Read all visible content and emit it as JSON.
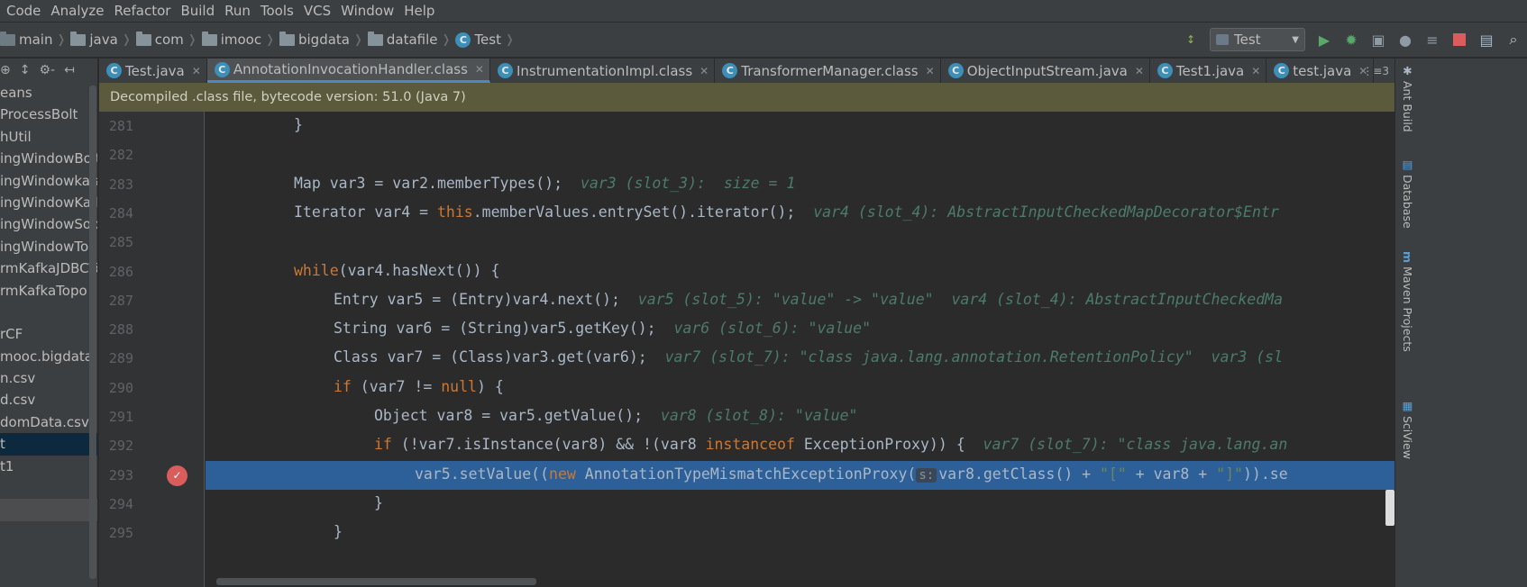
{
  "menu": [
    "Code",
    "Analyze",
    "Refactor",
    "Build",
    "Run",
    "Tools",
    "VCS",
    "Window",
    "Help"
  ],
  "breadcrumbs": [
    {
      "label": "main",
      "icon": "folder-icon"
    },
    {
      "label": "java",
      "icon": "folder-icon"
    },
    {
      "label": "com",
      "icon": "folder-icon"
    },
    {
      "label": "imooc",
      "icon": "folder-icon"
    },
    {
      "label": "bigdata",
      "icon": "folder-icon"
    },
    {
      "label": "datafile",
      "icon": "folder-icon"
    },
    {
      "label": "Test",
      "icon": "class-icon"
    }
  ],
  "run_config": {
    "label": "Test"
  },
  "project": {
    "items": [
      "eans",
      "ProcessBolt",
      "hUtil",
      "ingWindowBolt",
      "ingWindowkafaB",
      "ingWindowKafka",
      "ingWindowSopu",
      "ingWindowTopo",
      "rmKafkaJDBCTop",
      "rmKafkaTopo",
      "",
      "rCF",
      "mooc.bigdata.dat",
      "n.csv",
      "d.csv",
      "domData.csv",
      "t",
      "t1",
      "",
      "",
      ""
    ]
  },
  "tabs": [
    {
      "label": "Test.java",
      "active": false
    },
    {
      "label": "AnnotationInvocationHandler.class",
      "active": true
    },
    {
      "label": "InstrumentationImpl.class",
      "active": false
    },
    {
      "label": "TransformerManager.class",
      "active": false
    },
    {
      "label": "ObjectInputStream.java",
      "active": false
    },
    {
      "label": "Test1.java",
      "active": false
    },
    {
      "label": "test.java",
      "active": false
    }
  ],
  "tab_more": "⋮≡3",
  "banner": "Decompiled .class file, bytecode version: 51.0 (Java 7)",
  "lines": [
    {
      "num": "281"
    },
    {
      "num": "282"
    },
    {
      "num": "283"
    },
    {
      "num": "284"
    },
    {
      "num": "285"
    },
    {
      "num": "286"
    },
    {
      "num": "287"
    },
    {
      "num": "288"
    },
    {
      "num": "289"
    },
    {
      "num": "290"
    },
    {
      "num": "291"
    },
    {
      "num": "292"
    },
    {
      "num": "293"
    },
    {
      "num": "294"
    },
    {
      "num": "295"
    }
  ],
  "code": {
    "l281": "}",
    "l283a": "Map var3 = var2.memberTypes();",
    "l283b": "var3 (slot_3):  size = 1",
    "l284a": "Iterator var4 = ",
    "l284kw": "this",
    "l284b": ".memberValues.entrySet().iterator();",
    "l284c": "var4 (slot_4): AbstractInputCheckedMapDecorator$Entr",
    "l286kw": "while",
    "l286b": "(var4.hasNext()) {",
    "l287a": "Entry var5 = (Entry)var4.next();",
    "l287b": "var5 (slot_5): \"value\" -> \"value\"  var4 (slot_4): AbstractInputCheckedMa",
    "l288a": "String var6 = (String)var5.getKey();",
    "l288b": "var6 (slot_6): \"value\"",
    "l289a": "Class var7 = (Class)var3.get(var6);",
    "l289b": "var7 (slot_7): \"class java.lang.annotation.RetentionPolicy\"  var3 (sl",
    "l290kw": "if",
    "l290a": " (var7 != ",
    "l290kw2": "null",
    "l290b": ") {",
    "l291a": "Object var8 = var5.getValue();",
    "l291b": "var8 (slot_8): \"value\"",
    "l292kw": "if",
    "l292a": " (!var7.isInstance(var8) && !(var8 ",
    "l292kw2": "instanceof",
    "l292b": " ExceptionProxy)) {",
    "l292c": "var7 (slot_7): \"class java.lang.an",
    "l293a": "var5.setValue((",
    "l293kw": "new",
    "l293b": " AnnotationTypeMismatchExceptionProxy(",
    "l293hint": "s:",
    "l293c": "var8.getClass() + ",
    "l293s1": "\"[\"",
    "l293d": " + var8 + ",
    "l293s2": "\"]\"",
    "l293e": ")).se",
    "l294": "}",
    "l295": "}"
  },
  "right_tools": [
    "Ant Build",
    "Database",
    "Maven Projects",
    "SciView"
  ]
}
